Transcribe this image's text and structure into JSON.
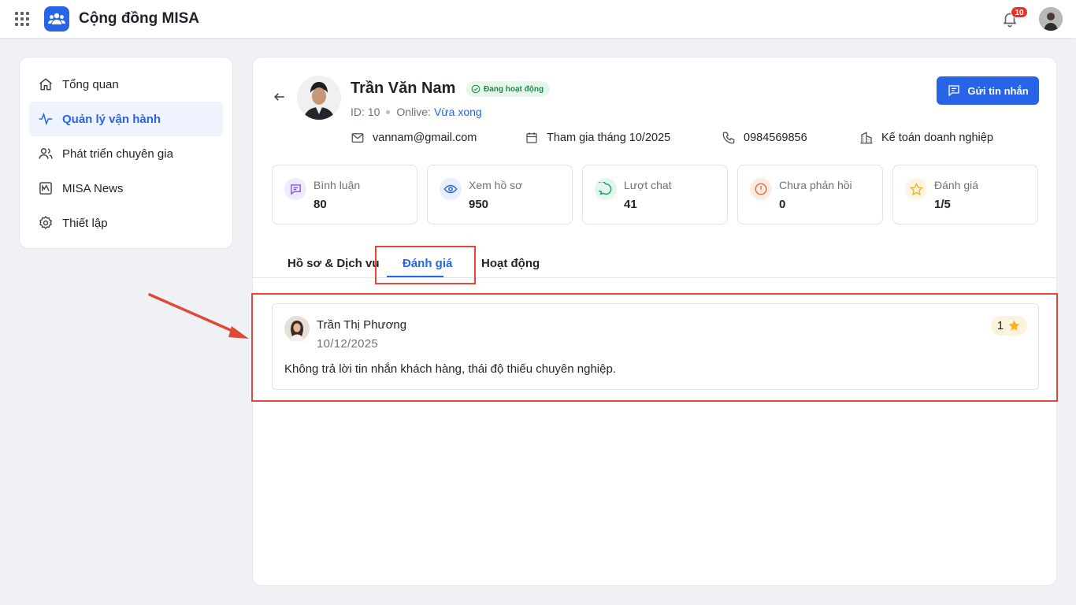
{
  "app": {
    "title": "Cộng đồng MISA",
    "notification_count": "10"
  },
  "sidebar": {
    "items": [
      {
        "label": "Tổng quan",
        "icon": "home-icon",
        "active": false
      },
      {
        "label": "Quản lý vận hành",
        "icon": "activity-icon",
        "active": true
      },
      {
        "label": "Phát triển chuyên gia",
        "icon": "users-icon",
        "active": false
      },
      {
        "label": "MISA News",
        "icon": "news-icon",
        "active": false
      },
      {
        "label": "Thiết lập",
        "icon": "gear-icon",
        "active": false
      }
    ]
  },
  "profile": {
    "name": "Trần Văn Nam",
    "status": "Đang hoạt động",
    "id_label": "ID: 10",
    "online_label": "Onlive:",
    "online_value": "Vừa xong",
    "email": "vannam@gmail.com",
    "joined": "Tham gia tháng 10/2025",
    "phone": "0984569856",
    "role": "Kế toán doanh nghiệp",
    "send_button": "Gửi tin nhắn"
  },
  "stats": [
    {
      "label": "Bình luận",
      "value": "80",
      "icon": "comment-icon",
      "color": "#7b5cf0"
    },
    {
      "label": "Xem hồ sơ",
      "value": "950",
      "icon": "eye-icon",
      "color": "#2864e8"
    },
    {
      "label": "Lượt chat",
      "value": "41",
      "icon": "chat-icon",
      "color": "#1fa463"
    },
    {
      "label": "Chưa phản hồi",
      "value": "0",
      "icon": "alert-icon",
      "color": "#f06a35"
    },
    {
      "label": "Đánh giá",
      "value": "1/5",
      "icon": "star-icon",
      "color": "#f5b324"
    }
  ],
  "tabs": [
    {
      "label": "Hồ sơ & Dịch vụ",
      "active": false
    },
    {
      "label": "Đánh giá",
      "active": true
    },
    {
      "label": "Hoạt động",
      "active": false
    }
  ],
  "reviews": [
    {
      "author": "Trần Thị Phương",
      "date": "10/12/2025",
      "rating": "1",
      "text": "Không trả lời tin nhắn khách hàng, thái độ thiếu chuyên nghiệp."
    }
  ],
  "colors": {
    "accent": "#2864e8",
    "highlight": "#e0493a",
    "success": "#1b8a47"
  }
}
